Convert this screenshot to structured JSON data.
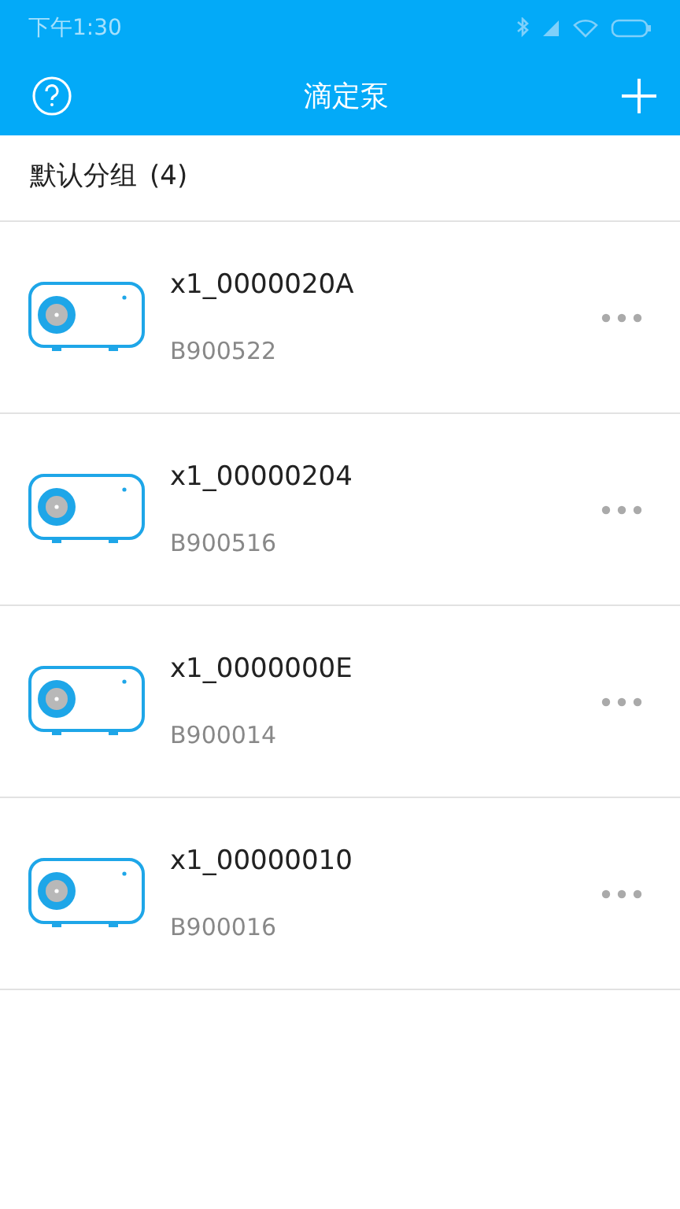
{
  "status_bar": {
    "time": "下午1:30"
  },
  "header": {
    "title": "滴定泵"
  },
  "group": {
    "label": "默认分组",
    "count": "(4)"
  },
  "devices": [
    {
      "name": "x1_0000020A",
      "code": "B900522"
    },
    {
      "name": "x1_00000204",
      "code": "B900516"
    },
    {
      "name": "x1_0000000E",
      "code": "B900014"
    },
    {
      "name": "x1_00000010",
      "code": "B900016"
    }
  ]
}
